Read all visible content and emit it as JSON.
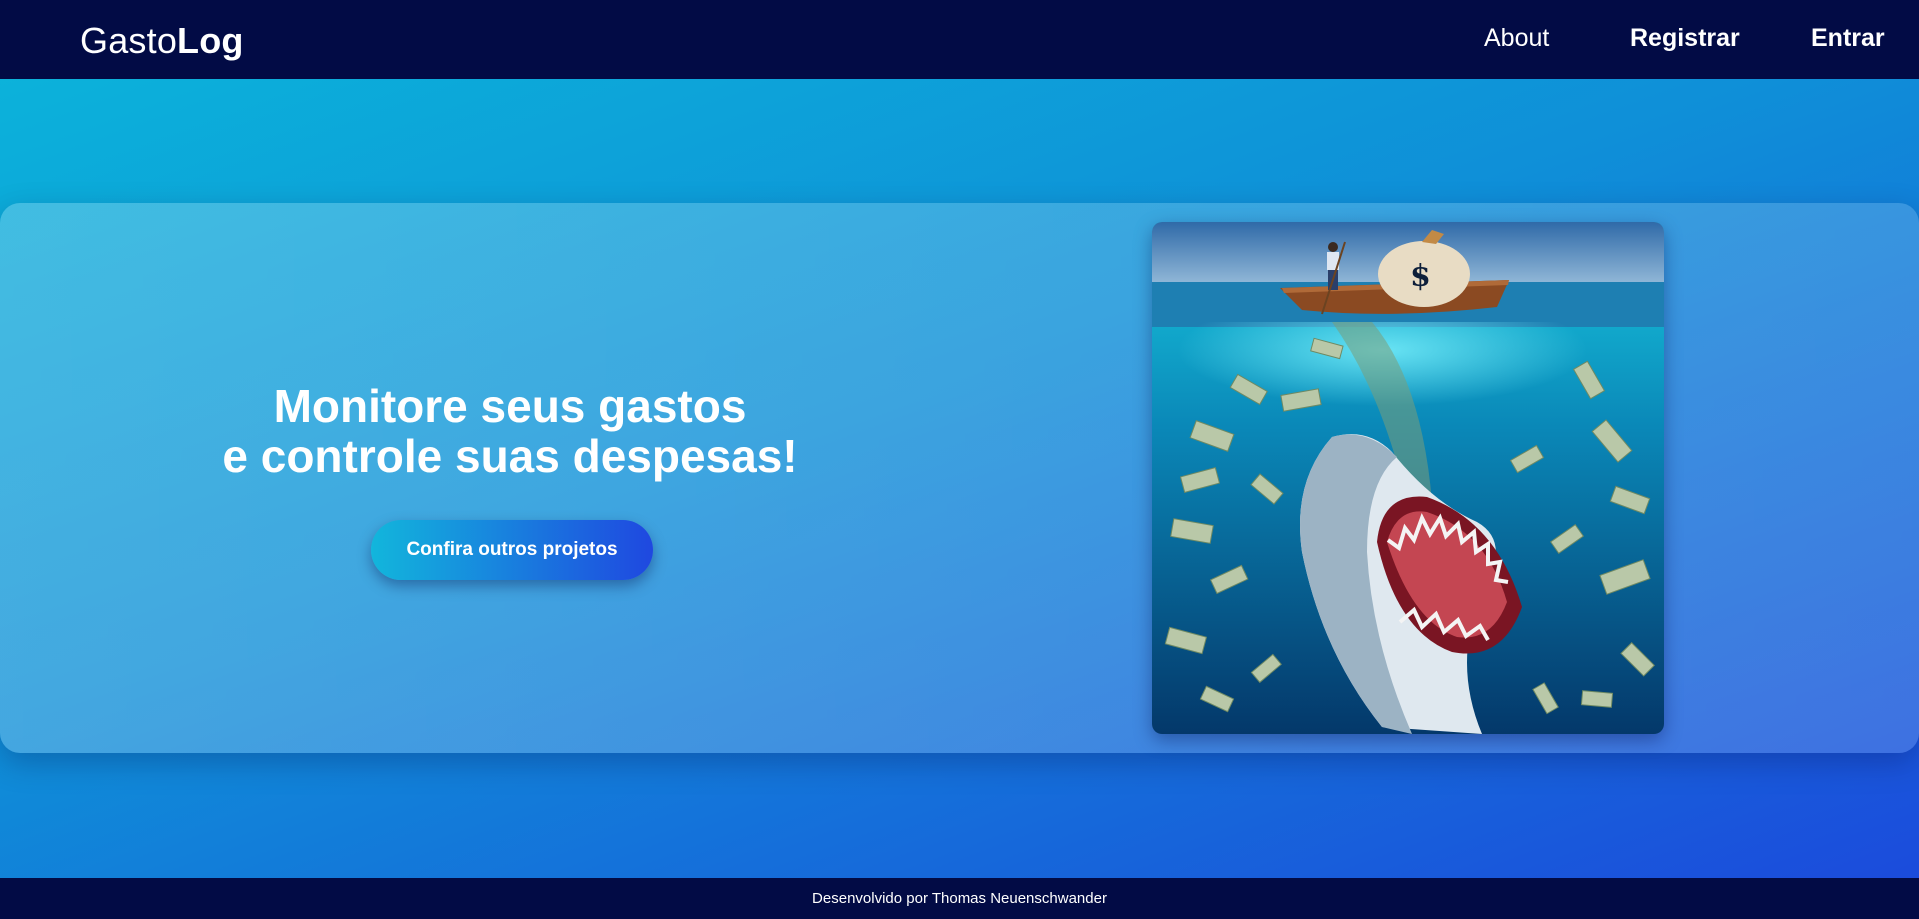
{
  "header": {
    "logo_light": "Gasto",
    "logo_bold": "Log",
    "nav": {
      "about": "About",
      "register": "Registrar",
      "login": "Entrar"
    }
  },
  "hero": {
    "title_line1": "Monitore seus gastos",
    "title_line2": "e controle suas despesas!",
    "cta_label": "Confira outros projetos",
    "image_caption": "Shark swallowing money from a boat"
  },
  "footer": {
    "text": "Desenvolvido por Thomas Neuenschwander"
  },
  "colors": {
    "topbar": "#020b45",
    "gradient_start": "#0bb6da",
    "gradient_end": "#1c48dc",
    "cta_start": "#12b6dc",
    "cta_end": "#1f48e0"
  }
}
